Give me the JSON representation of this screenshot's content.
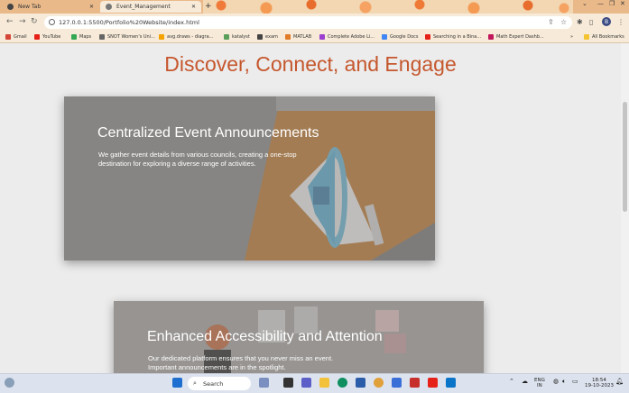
{
  "browser": {
    "tabs": [
      {
        "label": "New Tab",
        "active": false
      },
      {
        "label": "Event_Management",
        "active": true
      }
    ],
    "url": "127.0.0.1:5500/Portfolio%20Website/index.html",
    "profile_initial": "B",
    "bookmarks": [
      "Gmail",
      "YouTube",
      "Maps",
      "SNOT Women's Uni...",
      "avg.draws - diagra...",
      "katalyst",
      "exam",
      "MATLAB",
      "Complete Adobe Li...",
      "Google Docs",
      "Searching in a Bina...",
      "Math Expert Dashb..."
    ],
    "all_bookmarks": "All Bookmarks"
  },
  "page": {
    "heading": "Discover, Connect, and Engage",
    "heading_color": "#c5572d",
    "cards": [
      {
        "title": "Centralized Event Announcements",
        "description": "We gather event details from various councils, creating a one-stop destination for exploring a diverse range of activities."
      },
      {
        "title": "Enhanced Accessibility and Attention",
        "description": "Our dedicated platform ensures that you never miss an event. Important announcements are in the spotlight."
      }
    ]
  },
  "taskbar": {
    "search_label": "Search",
    "language": "ENG",
    "region": "IN",
    "time": "18:54",
    "date": "19-10-2023"
  }
}
